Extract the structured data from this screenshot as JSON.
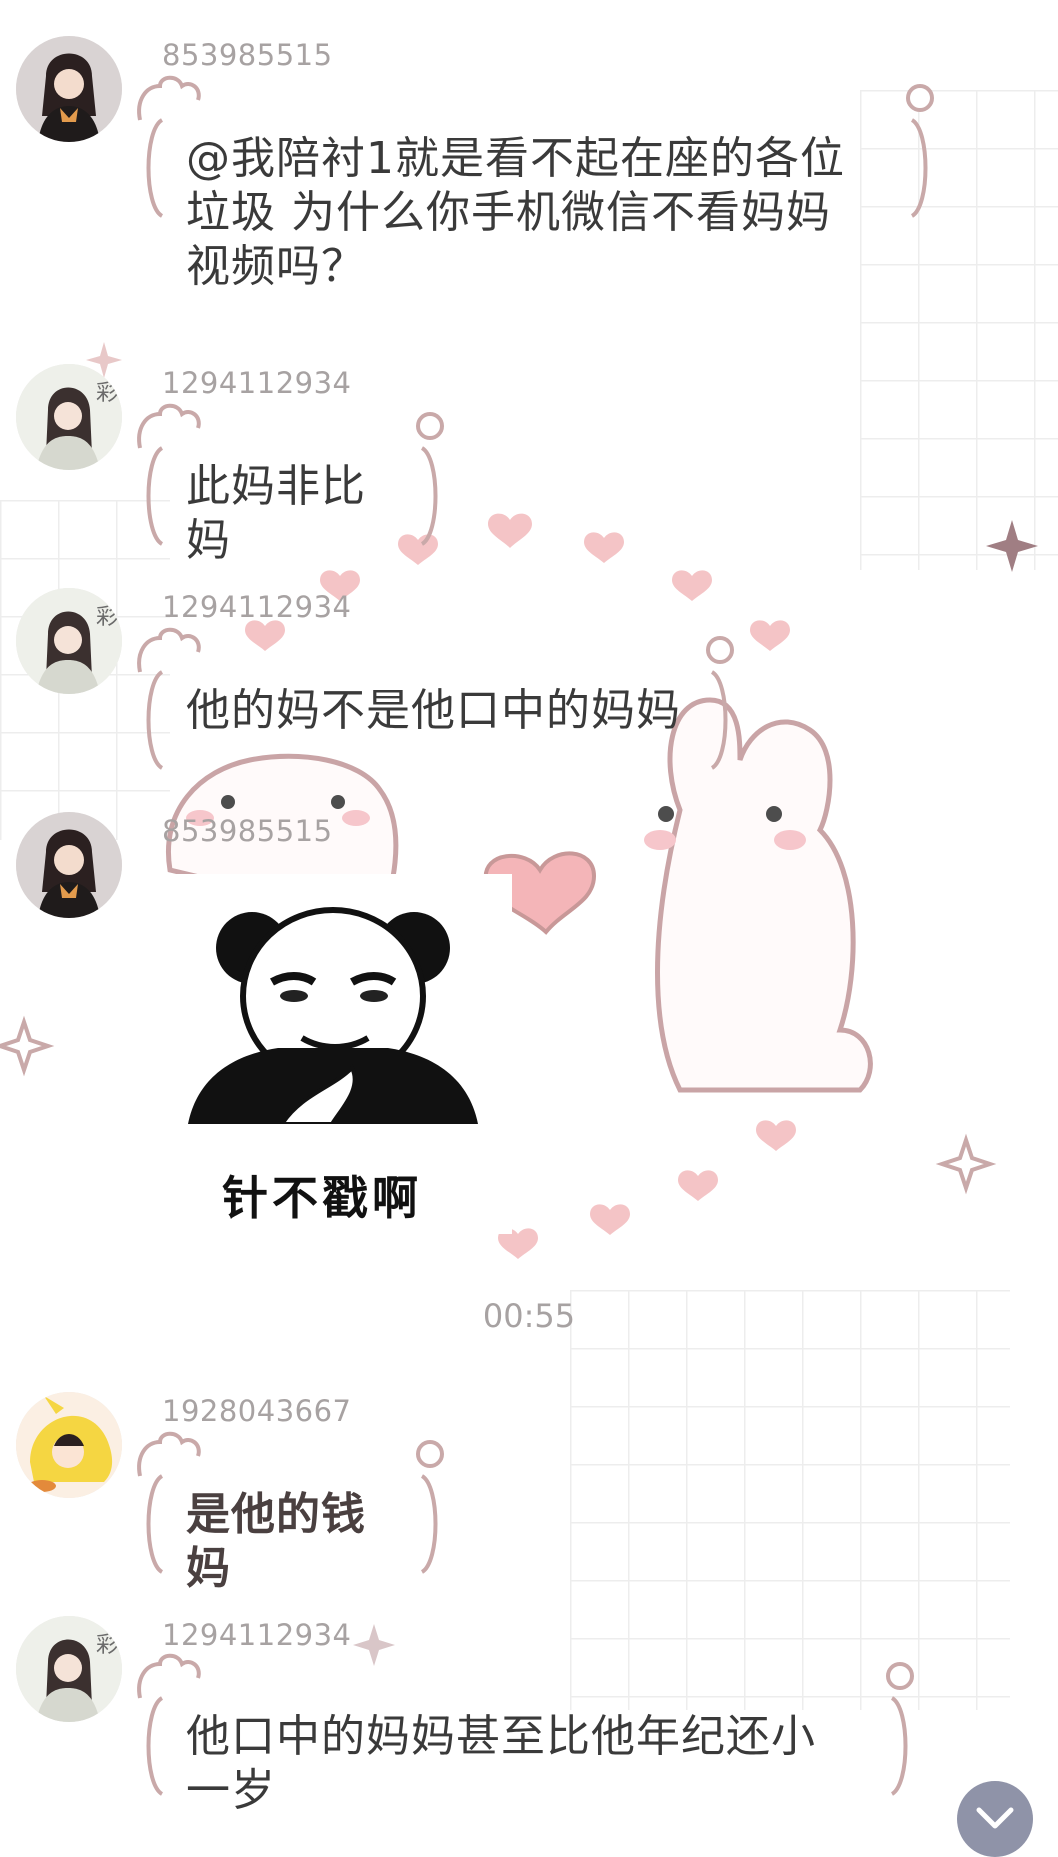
{
  "messages": [
    {
      "sender": "853985515",
      "text_lines": [
        "@我陪衬1就是看不起在座的各位",
        "垃圾 为什么你手机微信不看妈妈",
        "视频吗？"
      ]
    },
    {
      "sender": "1294112934",
      "text_lines": [
        "此妈非比妈"
      ]
    },
    {
      "sender": "1294112934",
      "text_lines": [
        "他的妈不是他口中的妈妈"
      ]
    },
    {
      "sender": "853985515",
      "sticker_caption": "针不戳啊"
    },
    {
      "sender": "1928043667",
      "text_lines": [
        "是他的钱妈"
      ]
    },
    {
      "sender": "1294112934",
      "text_lines": [
        "他口中的妈妈甚至比他年纪还小",
        "一岁"
      ]
    }
  ],
  "timestamp": "00:55",
  "icons": {
    "scroll_down": "chevron-down-icon"
  },
  "colors": {
    "bubble_outline": "#c9a9a9",
    "heart": "#f5c2c5",
    "sender_text": "#a7a2a2",
    "scroll_button": "#8f93a8"
  }
}
